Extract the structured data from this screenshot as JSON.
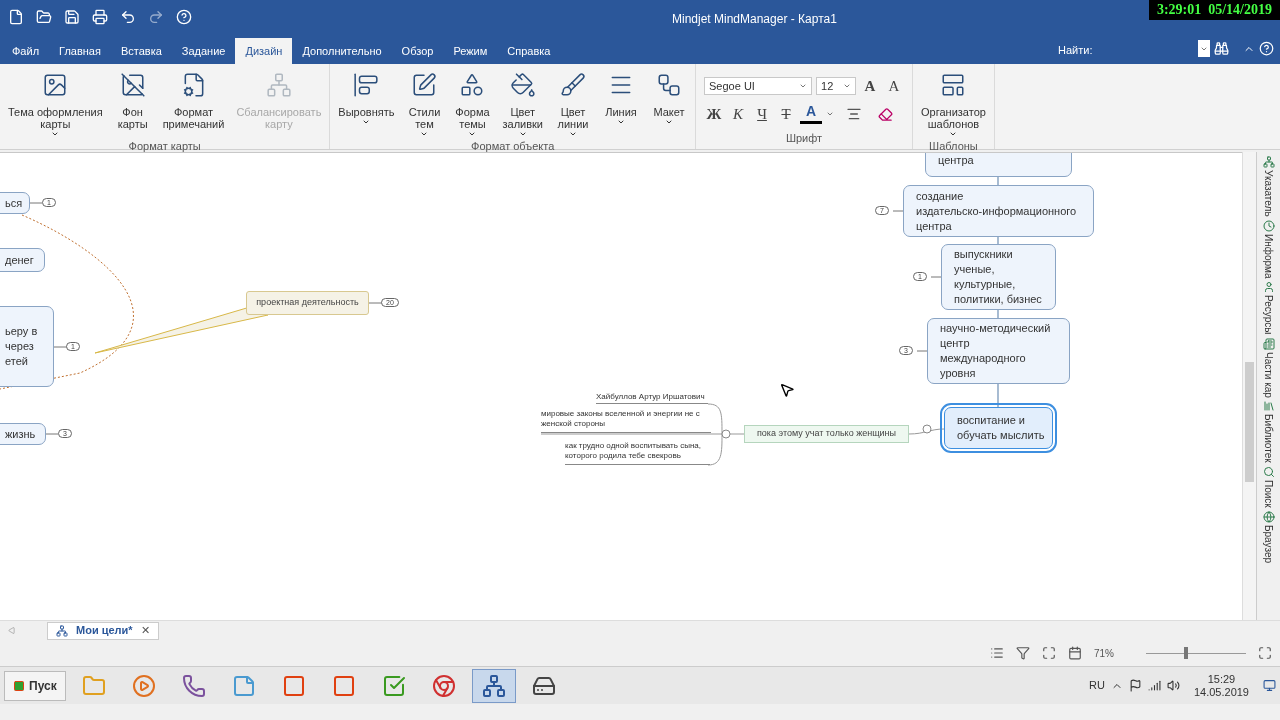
{
  "title_bar": {
    "title": "Mindjet MindManager - Карта1",
    "clock": "3:29:01  05/14/2019"
  },
  "tabs": [
    {
      "label": "Файл",
      "selected": false
    },
    {
      "label": "Главная",
      "selected": false
    },
    {
      "label": "Вставка",
      "selected": false
    },
    {
      "label": "Задание",
      "selected": false
    },
    {
      "label": "Дизайн",
      "selected": true
    },
    {
      "label": "Дополнительно",
      "selected": false
    },
    {
      "label": "Обзор",
      "selected": false
    },
    {
      "label": "Режим",
      "selected": false
    },
    {
      "label": "Справка",
      "selected": false
    }
  ],
  "search_label": "Найти:",
  "ribbon": [
    {
      "kind": "buttons",
      "label": "Формат карты",
      "buttons": [
        {
          "label": "Тема оформления\nкарты",
          "menu": true,
          "disabled": false
        },
        {
          "label": "Фон\nкарты",
          "menu": false,
          "disabled": false
        },
        {
          "label": "Формат\nпримечаний",
          "menu": false,
          "disabled": false
        },
        {
          "label": "Сбалансировать\nкарту",
          "menu": false,
          "disabled": true
        }
      ]
    },
    {
      "kind": "buttons",
      "label": "Формат объекта",
      "buttons": [
        {
          "label": "Выровнять",
          "menu": true,
          "disabled": false
        },
        {
          "label": "Стили\nтем",
          "menu": true,
          "disabled": false
        },
        {
          "label": "Форма\nтемы",
          "menu": true,
          "disabled": false
        },
        {
          "label": "Цвет\nзаливки",
          "menu": true,
          "disabled": false
        },
        {
          "label": "Цвет\nлинии",
          "menu": true,
          "disabled": false
        },
        {
          "label": "Линия",
          "menu": true,
          "disabled": false
        },
        {
          "label": "Макет",
          "menu": true,
          "disabled": false
        }
      ]
    },
    {
      "kind": "font",
      "label": "Шрифт",
      "font": "Segoe UI",
      "size": "12",
      "grow": "A",
      "shrink": "A",
      "bold": "Ж",
      "italic": "К",
      "underline": "Ч",
      "strike": "Т",
      "color_letter": "A"
    },
    {
      "kind": "buttons",
      "label": "Шаблоны",
      "buttons": [
        {
          "label": "Организатор\nшаблонов",
          "menu": true,
          "disabled": false
        }
      ]
    }
  ],
  "canvas": {
    "topics": [
      {
        "kind": "topic",
        "text": "ься",
        "count": "1",
        "selected": false
      },
      {
        "kind": "topic",
        "text": "денег",
        "selected": false
      },
      {
        "kind": "topic",
        "text": "ьеру в\nчерез\nетей",
        "count": "1",
        "selected": false
      },
      {
        "kind": "topic",
        "text": "жизнь",
        "count": "3",
        "selected": false
      },
      {
        "kind": "callout",
        "text": "проектная деятельность",
        "count": "20",
        "selected": false
      },
      {
        "kind": "note",
        "text": "Хайбуллов Артур Иршатович",
        "selected": false
      },
      {
        "kind": "note",
        "text": "мировые законы вселенной и энергии не с\nженской стороны",
        "selected": false
      },
      {
        "kind": "note",
        "text": "как трудно одной воспитывать сына,\nкоторого родила тебе свекровь",
        "selected": false
      },
      {
        "kind": "subtopic",
        "text": "пока этому учат только женщины",
        "selected": false
      },
      {
        "kind": "topic",
        "text": "центра",
        "selected": false
      },
      {
        "kind": "topic",
        "text": "создание\nиздательско-информационного\nцентра",
        "count": "7",
        "selected": false
      },
      {
        "kind": "topic",
        "text": "выпускники\nученые,\nкультурные,\nполитики, бизнес",
        "count": "1",
        "selected": false
      },
      {
        "kind": "topic",
        "text": "научно-методический\nцентр\nмеждународного\nуровня",
        "count": "3",
        "selected": false
      },
      {
        "kind": "topic",
        "text": "воспитание и\nобучать мыслить",
        "selected": true
      }
    ]
  },
  "side_panel": [
    "Указатель",
    "Информа",
    "Ресурсы",
    "Части кар",
    "Библиотек",
    "Поиск",
    "Браузер"
  ],
  "doc_tab": {
    "title": "Мои цели*",
    "close": "✕"
  },
  "status_bar": {
    "zoom": "71%",
    "zoom_slider": {
      "level": 0.38
    }
  },
  "taskbar": {
    "start": "Пуск",
    "apps": [
      {
        "kind": "folder",
        "selected": false
      },
      {
        "kind": "media",
        "selected": false
      },
      {
        "kind": "phone",
        "selected": false
      },
      {
        "kind": "notes",
        "selected": false
      },
      {
        "kind": "office",
        "selected": false
      },
      {
        "kind": "office",
        "selected": false
      },
      {
        "kind": "check",
        "selected": false
      },
      {
        "kind": "browser",
        "selected": false
      },
      {
        "kind": "mindmap",
        "selected": true
      },
      {
        "kind": "disk",
        "selected": false
      }
    ],
    "lang": "RU",
    "time": "15:29",
    "date": "14.05.2019"
  }
}
